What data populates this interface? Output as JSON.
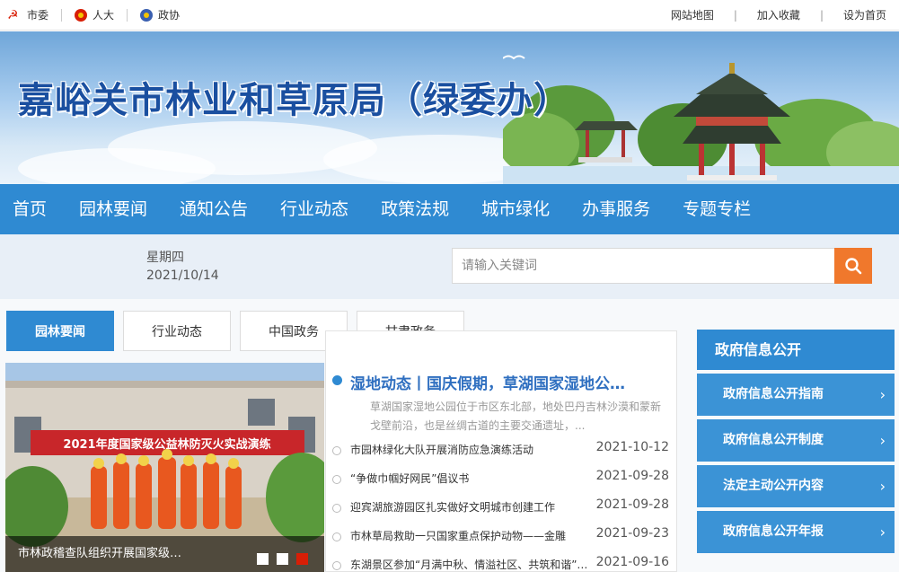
{
  "topbar": {
    "left_links": [
      {
        "label": "市委",
        "icon": "party-emblem-icon"
      },
      {
        "label": "人大",
        "icon": "national-emblem-icon"
      },
      {
        "label": "政协",
        "icon": "cppcc-emblem-icon"
      }
    ],
    "right_links": [
      "网站地图",
      "加入收藏",
      "设为首页"
    ],
    "separator": "|"
  },
  "banner": {
    "title": "嘉峪关市林业和草原局（绿委办）"
  },
  "nav": {
    "items": [
      "首页",
      "园林要闻",
      "通知公告",
      "行业动态",
      "政策法规",
      "城市绿化",
      "办事服务",
      "专题专栏"
    ]
  },
  "infobar": {
    "weekday": "星期四",
    "date": "2021/10/14",
    "search_placeholder": "请输入关键词"
  },
  "tabs": [
    "园林要闻",
    "行业动态",
    "中国政务",
    "甘肃政务"
  ],
  "slider": {
    "caption": "市林政稽查队组织开展国家级…",
    "banner_text": "2021年度国家级公益林防灭火实战演练",
    "active_dot": 2
  },
  "headline": {
    "title": "湿地动态丨国庆假期，草湖国家湿地公…",
    "summary": "草湖国家湿地公园位于市区东北部，地处巴丹吉林沙漠和蒙新戈壁前沿，也是丝绸古道的主要交通遗址，..."
  },
  "news": [
    {
      "title": "市园林绿化大队开展消防应急演练活动",
      "date": "2021-10-12"
    },
    {
      "title": "“争做巾帼好网民”倡议书",
      "date": "2021-09-28"
    },
    {
      "title": "迎宾湖旅游园区扎实做好文明城市创建工作",
      "date": "2021-09-28"
    },
    {
      "title": "市林草局救助一只国家重点保护动物——金雕",
      "date": "2021-09-23"
    },
    {
      "title": "东湖景区参加“月满中秋、情溢社区、共筑和谐”…",
      "date": "2021-09-16"
    }
  ],
  "sidebar": {
    "header": "政府信息公开",
    "items": [
      "政府信息公开指南",
      "政府信息公开制度",
      "法定主动公开内容",
      "政府信息公开年报"
    ],
    "chevron": "›"
  },
  "colors": {
    "primary_blue": "#2f8ad2",
    "search_orange": "#f0782c",
    "active_dot_red": "#d81e06"
  }
}
